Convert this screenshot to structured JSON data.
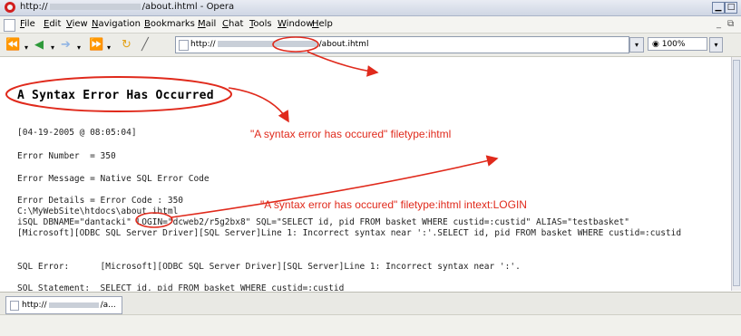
{
  "window": {
    "title_prefix": "http://",
    "title_suffix": "/about.ihtml - Opera"
  },
  "menu": [
    "File",
    "Edit",
    "View",
    "Navigation",
    "Bookmarks",
    "Mail",
    "Chat",
    "Tools",
    "Window",
    "Help"
  ],
  "address": {
    "prefix": "http://",
    "suffix": "/about.ihtml"
  },
  "zoom": "100%",
  "page": {
    "heading": "A Syntax Error Has Occurred",
    "timestamp": "[04-19-2005 @ 08:05:04]",
    "error_number": "Error Number  = 350",
    "error_message": "Error Message = Native SQL Error Code",
    "error_details": "Error Details = Error Code : 350",
    "path": "C:\\MyWebSite\\htdocs\\about.ihtml",
    "isql_before": "iSQL DBNAME=\"dantacki\" ",
    "isql_login": "LOGIN",
    "isql_after": "=\"dcweb2/r5g2bx8\" SQL=\"SELECT id, pid FROM basket WHERE custid=:custid\" ALIAS=\"testbasket\"",
    "driver_line": "[Microsoft][ODBC SQL Server Driver][SQL Server]Line 1: Incorrect syntax near ':'.SELECT id, pid FROM basket WHERE custid=:custid",
    "sql_error": "SQL Error:      [Microsoft][ODBC SQL Server Driver][SQL Server]Line 1: Incorrect syntax near ':'.",
    "sql_statement": "SQL Statement:  SELECT id, pid FROM basket WHERE custid=:custid"
  },
  "annotations": {
    "note1": "\"A syntax error has occured\" filetype:ihtml",
    "note2": "\"A syntax error has occured\" filetype:ihtml intext:LOGIN"
  },
  "tab": {
    "label_prefix": "http://",
    "label_suffix": "/a..."
  },
  "colors": {
    "annotation": "#e02a1c"
  }
}
